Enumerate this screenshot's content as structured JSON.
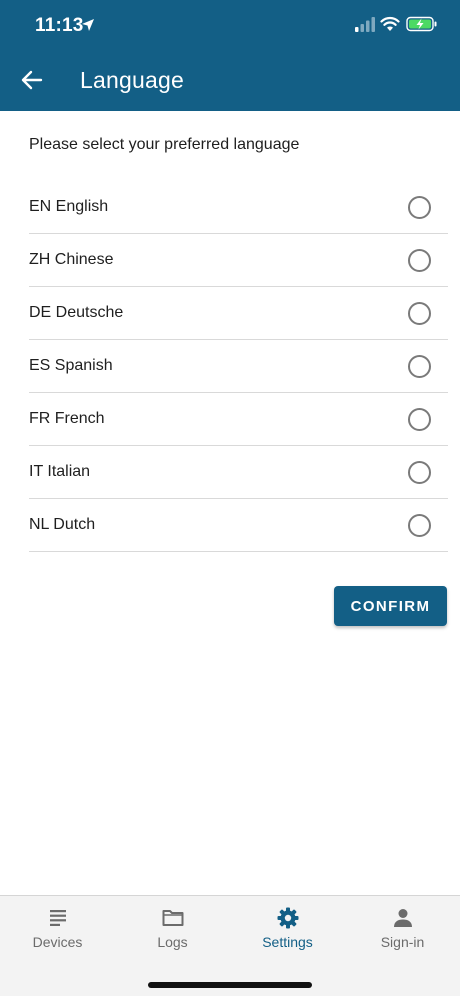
{
  "status_bar": {
    "time": "11:13"
  },
  "header": {
    "title": "Language",
    "accent": "#135f86"
  },
  "prompt": "Please select your preferred language",
  "languages": [
    {
      "label": "EN English"
    },
    {
      "label": "ZH Chinese"
    },
    {
      "label": "DE Deutsche"
    },
    {
      "label": "ES Spanish"
    },
    {
      "label": "FR French"
    },
    {
      "label": "IT Italian"
    },
    {
      "label": "NL Dutch"
    }
  ],
  "confirm_label": "CONFIRM",
  "tabs": [
    {
      "label": "Devices",
      "icon": "list-icon",
      "active": false
    },
    {
      "label": "Logs",
      "icon": "folder-icon",
      "active": false
    },
    {
      "label": "Settings",
      "icon": "gear-icon",
      "active": true
    },
    {
      "label": "Sign-in",
      "icon": "person-icon",
      "active": false
    }
  ]
}
